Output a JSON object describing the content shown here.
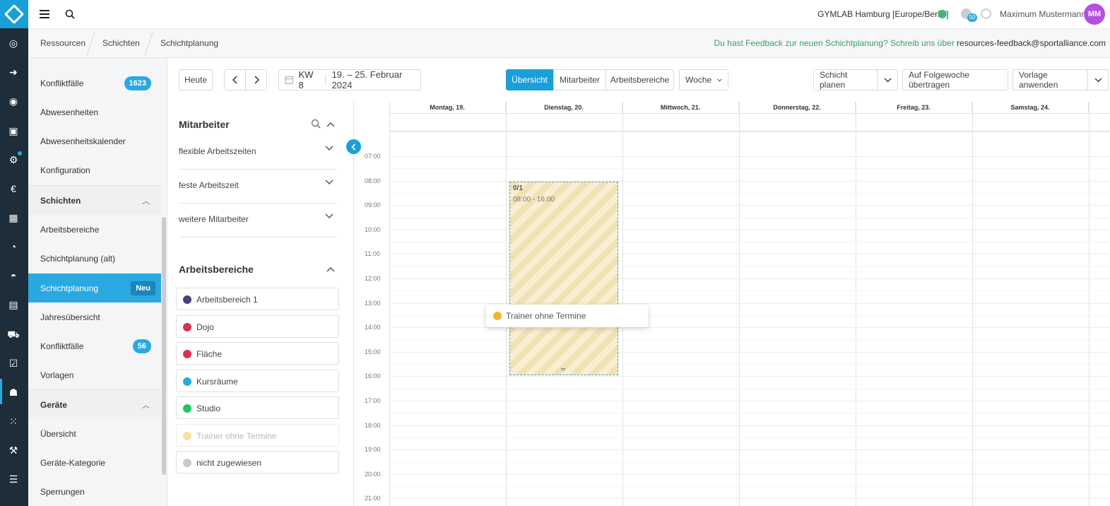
{
  "header": {
    "location": "GYMLAB Hamburg [Europe/Berlin]",
    "download_badge": "50",
    "user_name": "Maximum Mustermann",
    "avatar_initials": "MM"
  },
  "breadcrumb": {
    "items": [
      "Ressourcen",
      "Schichten",
      "Schichtplanung"
    ],
    "feedback_text": "Du hast Feedback zur neuen Schichtplanung? Schreib uns über",
    "feedback_email": "resources-feedback@sportalliance.com"
  },
  "sidebar": {
    "items": [
      {
        "label": "Konfliktfälle",
        "badge": "1623"
      },
      {
        "label": "Abwesenheiten"
      },
      {
        "label": "Abwesenheitskalender"
      },
      {
        "label": "Konfiguration"
      },
      {
        "label": "Schichten"
      },
      {
        "label": "Arbeitsbereiche"
      },
      {
        "label": "Schichtplanung (alt)"
      },
      {
        "label": "Schichtplanung",
        "badge": "Neu"
      },
      {
        "label": "Jahresübersicht"
      },
      {
        "label": "Konfliktfälle",
        "badge": "56"
      },
      {
        "label": "Vorlagen"
      },
      {
        "label": "Geräte"
      },
      {
        "label": "Übersicht"
      },
      {
        "label": "Geräte-Kategorie"
      },
      {
        "label": "Sperrungen"
      }
    ]
  },
  "toolbar": {
    "today": "Heute",
    "week": "KW 8",
    "date_range": "19. – 25. Februar 2024",
    "views": [
      "Übersicht",
      "Mitarbeiter",
      "Arbeitsbereiche"
    ],
    "period": "Woche",
    "plan_shift": "Schicht planen",
    "transfer": "Auf Folgewoche übertragen",
    "apply_template": "Vorlage anwenden"
  },
  "filters": {
    "employees_title": "Mitarbeiter",
    "employee_groups": [
      "flexible Arbeitszeiten",
      "feste Arbeitszeit",
      "weitere Mitarbeiter"
    ],
    "areas_title": "Arbeitsbereiche",
    "areas": [
      {
        "label": "Arbeitsbereich 1",
        "color": "#4b3f7d"
      },
      {
        "label": "Dojo",
        "color": "#d9334f"
      },
      {
        "label": "Fläche",
        "color": "#d9334f"
      },
      {
        "label": "Kursräume",
        "color": "#29a9e0"
      },
      {
        "label": "Studio",
        "color": "#22c55e"
      },
      {
        "label": "Trainer ohne Termine",
        "color": "#f2b632"
      },
      {
        "label": "nicht zugewiesen",
        "color": "#c9c9c9"
      }
    ]
  },
  "calendar": {
    "days": [
      "Montag, 19.",
      "Dienstag, 20.",
      "Mittwoch, 21.",
      "Donnerstag, 22.",
      "Freitag, 23.",
      "Samstag, 24."
    ],
    "hours": [
      "07:00",
      "08:00",
      "09:00",
      "10:00",
      "11:00",
      "12:00",
      "13:00",
      "14:00",
      "15:00",
      "16:00",
      "17:00",
      "18:00",
      "19:00",
      "20:00",
      "21:00"
    ],
    "shift": {
      "count": "0/1",
      "time": "08:00 - 16:00"
    },
    "tooltip": "Trainer ohne Termine"
  }
}
